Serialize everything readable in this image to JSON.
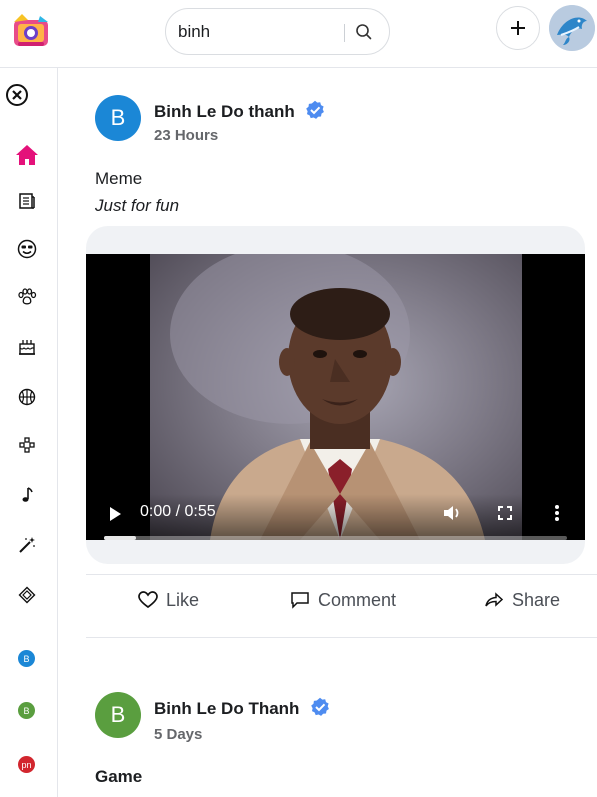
{
  "header": {
    "search": {
      "value": "binh",
      "placeholder": ""
    }
  },
  "sidebar": {
    "items": [
      {
        "name": "home",
        "icon": "home-icon",
        "active": true
      },
      {
        "name": "news",
        "icon": "newspaper-icon"
      },
      {
        "name": "fun",
        "icon": "smile-sunglasses-icon"
      },
      {
        "name": "pets",
        "icon": "paw-icon"
      },
      {
        "name": "food",
        "icon": "cake-icon"
      },
      {
        "name": "sports",
        "icon": "basketball-icon"
      },
      {
        "name": "games",
        "icon": "gamepad-icon"
      },
      {
        "name": "music",
        "icon": "music-note-icon"
      },
      {
        "name": "magic",
        "icon": "magic-wand-icon"
      },
      {
        "name": "other",
        "icon": "cube-icon"
      }
    ],
    "badges": [
      {
        "label": "B",
        "color": "#1b87d6"
      },
      {
        "label": "B",
        "color": "#5a9e3f"
      },
      {
        "label": "pn",
        "color": "#d2262e"
      }
    ]
  },
  "posts": [
    {
      "avatar_letter": "B",
      "avatar_color": "#1b87d6",
      "author": "Binh Le Do thanh",
      "time": "23 Hours",
      "title": "Meme",
      "description": "Just for fun",
      "video": {
        "time": "0:00 / 0:55",
        "progress": 0.07
      },
      "actions": {
        "like": "Like",
        "comment": "Comment",
        "share": "Share"
      }
    },
    {
      "avatar_letter": "B",
      "avatar_color": "#5a9e3f",
      "author": "Binh Le Do Thanh",
      "time": "5 Days",
      "title": "Game"
    }
  ],
  "colors": {
    "accent": "#e4117a",
    "verified": "#1877f2"
  }
}
